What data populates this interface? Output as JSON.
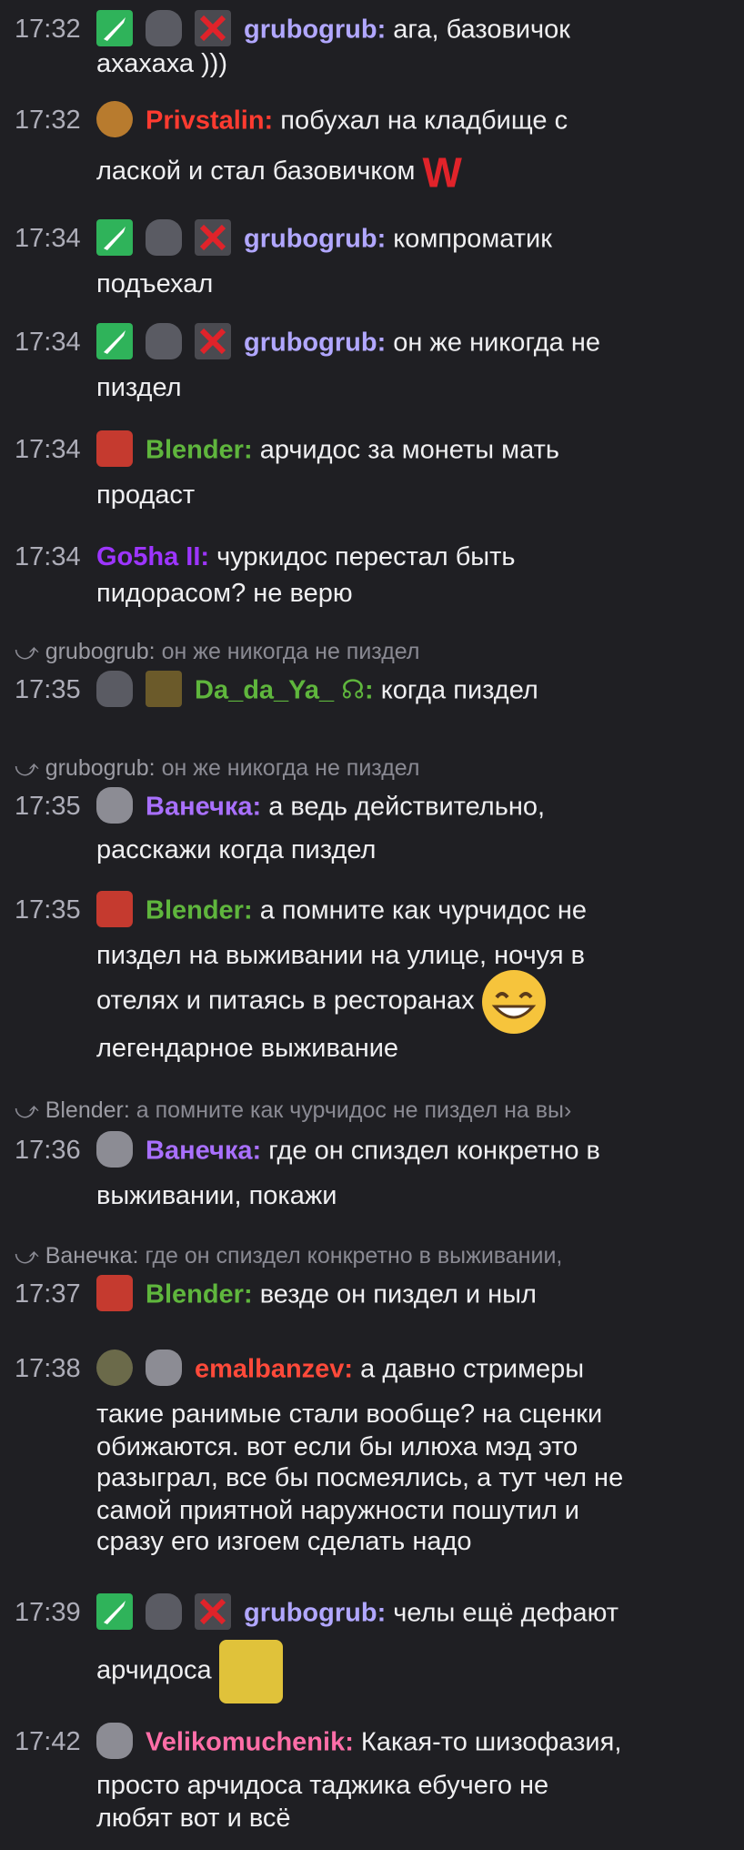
{
  "colors": {
    "background": "#1f1f23",
    "timestamp": "#adadb8",
    "grubogrub": "#b1a7ff",
    "privstalin": "#ff3b30",
    "blender": "#5fb63d",
    "go5ha": "#9d35ff",
    "da_da_ya": "#5fb63d",
    "vanechka": "#a970ff",
    "emalbanzev": "#ff4a3a",
    "velikomuchenik": "#ff6ea8"
  },
  "messages": [
    {
      "time": "17:32",
      "user": "grubogrub:",
      "text1": "ага, базовичок",
      "text2": "ахахаха )))"
    },
    {
      "time": "17:32",
      "user": "Privstalin:",
      "text1": "побухал на кладбище с",
      "text2": "лаской и стал базовичком",
      "emote": "W"
    },
    {
      "time": "17:34",
      "user": "grubogrub:",
      "text1": "компроматик",
      "text2": "подъехал"
    },
    {
      "time": "17:34",
      "user": "grubogrub:",
      "text1": "он же никогда не",
      "text2": "пиздел"
    },
    {
      "time": "17:34",
      "user": "Blender:",
      "text1": "арчидос за монеты мать",
      "text2": "продаст"
    },
    {
      "time": "17:34",
      "user": "Go5ha II:",
      "text1": "чуркидос перестал быть",
      "text2": "пидорасом? не верю"
    },
    {
      "reply_user": "grubogrub:",
      "reply_text": "он же никогда не пиздел",
      "time": "17:35",
      "user": "Da_da_Ya_ ☊:",
      "text1": "когда пиздел"
    },
    {
      "reply_user": "grubogrub:",
      "reply_text": "он же никогда не пиздел",
      "time": "17:35",
      "user": "Ванечка:",
      "text1": "а ведь действительно,",
      "text2": "расскажи когда пиздел"
    },
    {
      "time": "17:35",
      "user": "Blender:",
      "text1": "а помните как чурчидос не",
      "text2": "пиздел на выживании на улице, ночуя в",
      "text3": "отелях и питаясь в ресторанах",
      "text4": "легендарное выживание"
    },
    {
      "reply_user": "Blender:",
      "reply_text": "а помните как чурчидос не пиздел на вы›",
      "time": "17:36",
      "user": "Ванечка:",
      "text1": "где он спиздел конкретно в",
      "text2": "выживании, покажи"
    },
    {
      "reply_user": "Ванечка:",
      "reply_text": "где он спиздел конкретно в выживании,",
      "time": "17:37",
      "user": "Blender:",
      "text1": "везде он пиздел и ныл"
    },
    {
      "time": "17:38",
      "user": "emalbanzev:",
      "text1": "а давно стримеры",
      "text2": "такие ранимые стали вообще? на сценки",
      "text3": "обижаются. вот если бы илюха мэд это",
      "text4": "разыграл, все бы посмеялись, а тут чел не",
      "text5": "самой приятной наружности пошутил и",
      "text6": "сразу его изгоем сделать надо"
    },
    {
      "time": "17:39",
      "user": "grubogrub:",
      "text1": "челы ещё дефают",
      "text2": "арчидоса"
    },
    {
      "time": "17:42",
      "user": "Velikomuchenik:",
      "text1": "Какая-то шизофазия,",
      "text2": "просто арчидоса таджика ебучего не",
      "text3": "любят вот и всё"
    }
  ]
}
